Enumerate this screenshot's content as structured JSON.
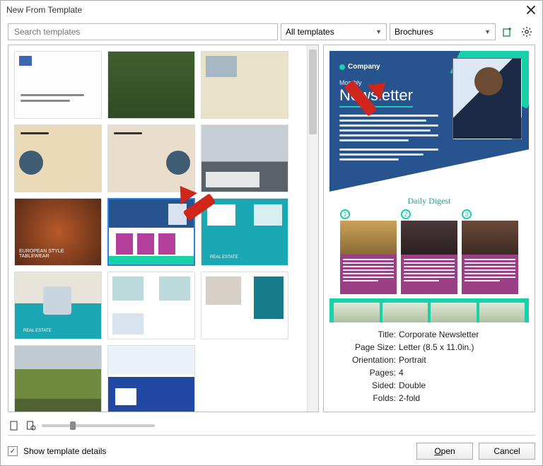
{
  "window": {
    "title": "New From Template"
  },
  "toolbar": {
    "search_placeholder": "Search templates",
    "filter1": "All templates",
    "filter2": "Brochures"
  },
  "preview": {
    "company_label": "Company",
    "month_label": "Monthly",
    "title": "Newsletter",
    "digest": "Daily Digest",
    "card_nums": [
      "1",
      "2",
      "3"
    ]
  },
  "meta": {
    "title_k": "Title:",
    "title_v": "Corporate Newsletter",
    "size_k": "Page Size:",
    "size_v": "Letter (8.5 x 11.0in.)",
    "orient_k": "Orientation:",
    "orient_v": "Portrait",
    "pages_k": "Pages:",
    "pages_v": "4",
    "sided_k": "Sided:",
    "sided_v": "Double",
    "folds_k": "Folds:",
    "folds_v": "2-fold"
  },
  "footer": {
    "details_label": "Show template details",
    "open": "Open",
    "cancel": "Cancel"
  },
  "open_underlined": "O"
}
